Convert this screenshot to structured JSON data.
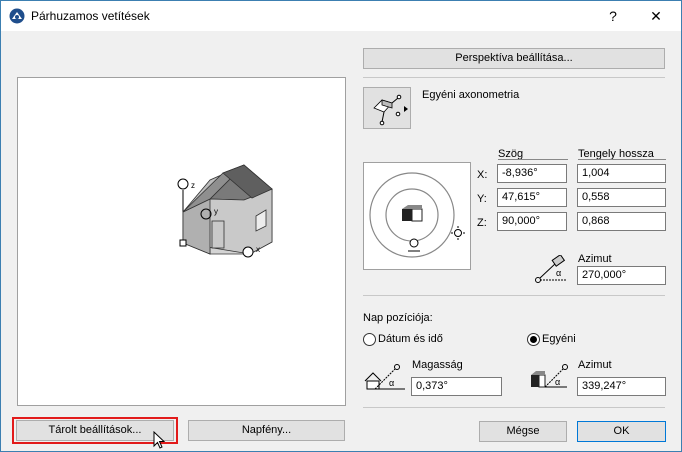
{
  "window": {
    "title": "Párhuzamos vetítések",
    "help": "?",
    "close": "✕"
  },
  "preview": {
    "axis_labels": {
      "z": "z",
      "y": "y",
      "x": "x"
    }
  },
  "perspective_button": "Perspektíva beállítása...",
  "projection_type": "Egyéni axonometria",
  "headers": {
    "angle": "Szög",
    "axis_length": "Tengely hossza"
  },
  "axes": [
    {
      "label": "X:",
      "angle": "-8,936°",
      "length": "1,004"
    },
    {
      "label": "Y:",
      "angle": "47,615°",
      "length": "0,558"
    },
    {
      "label": "Z:",
      "angle": "90,000°",
      "length": "0,868"
    }
  ],
  "azimuth_top": {
    "label": "Azimut",
    "value": "270,000°"
  },
  "sun": {
    "section_label": "Nap pozíciója:",
    "radio_date": "Dátum és idő",
    "radio_custom": "Egyéni",
    "selected": "custom",
    "height_label": "Magasság",
    "height_value": "0,373°",
    "azimuth_label": "Azimut",
    "azimuth_value": "339,247°"
  },
  "buttons": {
    "stored": "Tárolt beállítások...",
    "sunlight": "Napfény...",
    "cancel": "Mégse",
    "ok": "OK"
  },
  "colors": {
    "highlight_red": "#e21b1b",
    "ok_border": "#0078d7",
    "window_border": "#3c7fb1"
  }
}
